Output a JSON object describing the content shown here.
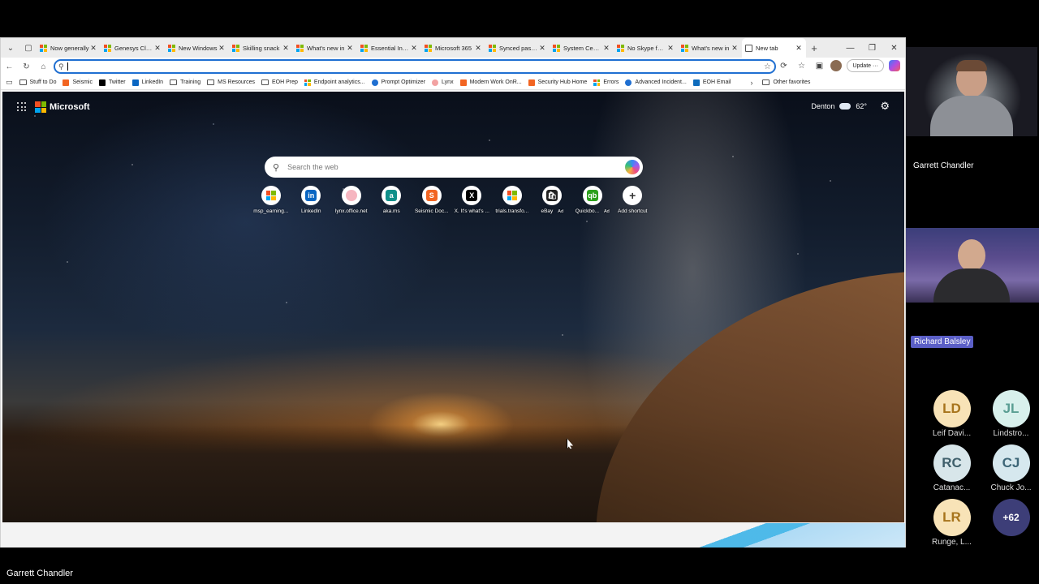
{
  "browser": {
    "tabs": [
      {
        "label": "Now generally",
        "fav": "ms"
      },
      {
        "label": "Genesys Clouc",
        "fav": "ms"
      },
      {
        "label": "New Windows",
        "fav": "ms"
      },
      {
        "label": "Skilling snack",
        "fav": "ms"
      },
      {
        "label": "What's new in",
        "fav": "ms"
      },
      {
        "label": "Essential Intun",
        "fav": "ms"
      },
      {
        "label": "Microsoft 365",
        "fav": "ms"
      },
      {
        "label": "Synced passke",
        "fav": "ms"
      },
      {
        "label": "System Center",
        "fav": "ms"
      },
      {
        "label": "No Skype for E",
        "fav": "ms"
      },
      {
        "label": "What's new in",
        "fav": "ms"
      },
      {
        "label": "New tab",
        "fav": "page",
        "active": true
      }
    ],
    "address": {
      "value": ""
    },
    "update_label": "Update",
    "favorites": [
      {
        "label": "Stuff to Do",
        "icon": "folder-icon"
      },
      {
        "label": "Seismic",
        "icon": "seismic-icon"
      },
      {
        "label": "Twitter",
        "icon": "x-icon"
      },
      {
        "label": "LinkedIn",
        "icon": "linkedin-icon"
      },
      {
        "label": "Training",
        "icon": "folder-icon"
      },
      {
        "label": "MS Resources",
        "icon": "folder-icon"
      },
      {
        "label": "EOH Prep",
        "icon": "folder-icon"
      },
      {
        "label": "Endpoint analytics...",
        "icon": "ms-icon"
      },
      {
        "label": "Prompt Optimizer",
        "icon": "globe-icon"
      },
      {
        "label": "Lynx",
        "icon": "lynx-icon"
      },
      {
        "label": "Modern Work OnR...",
        "icon": "seismic-icon"
      },
      {
        "label": "Security Hub Home",
        "icon": "seismic-icon"
      },
      {
        "label": "Errors",
        "icon": "ms-icon"
      },
      {
        "label": "Advanced Incident...",
        "icon": "globe-icon"
      },
      {
        "label": "EOH Email",
        "icon": "outlook-icon"
      }
    ],
    "other_favorites": "Other favorites"
  },
  "ntp": {
    "brand": "Microsoft",
    "location": "Denton",
    "temperature": "62°",
    "search_placeholder": "Search the web",
    "shortcuts": [
      {
        "label": "msp_earning...",
        "icon": "ms-icon",
        "ad": ""
      },
      {
        "label": "LinkedIn",
        "icon": "linkedin-icon",
        "ad": ""
      },
      {
        "label": "lynx.office.net",
        "icon": "lynx-icon",
        "ad": ""
      },
      {
        "label": "aka.ms",
        "icon": "akams-icon",
        "ad": ""
      },
      {
        "label": "Seismic Doc...",
        "icon": "seismic-icon",
        "ad": ""
      },
      {
        "label": "X. It's what's ...",
        "icon": "x-icon",
        "ad": ""
      },
      {
        "label": "trials.transfo...",
        "icon": "ms-icon",
        "ad": ""
      },
      {
        "label": "eBay",
        "icon": "ebay-icon",
        "ad": "Ad"
      },
      {
        "label": "Quickbo...",
        "icon": "quickbooks-icon",
        "ad": "Ad"
      },
      {
        "label": "Add shortcut",
        "icon": "plus-icon",
        "ad": ""
      }
    ]
  },
  "meeting": {
    "participant_top": "Garrett Chandler",
    "participant_second": "Richard Balsley",
    "people": [
      {
        "initials": "LD",
        "name": "Leif Davi...",
        "bg": "#f8e3b7",
        "fg": "#a7741c"
      },
      {
        "initials": "JL",
        "name": "Lindstro...",
        "bg": "#d8f0ec",
        "fg": "#5a9e93"
      },
      {
        "initials": "RC",
        "name": "Catanac...",
        "bg": "#d8e6ea",
        "fg": "#3f5f6b"
      },
      {
        "initials": "CJ",
        "name": "Chuck Jo...",
        "bg": "#d6e8ee",
        "fg": "#3d6677"
      },
      {
        "initials": "LR",
        "name": "Runge, L...",
        "bg": "#f8e3b7",
        "fg": "#a7741c"
      }
    ],
    "more_count": "+62",
    "presenter": "Garrett Chandler"
  }
}
